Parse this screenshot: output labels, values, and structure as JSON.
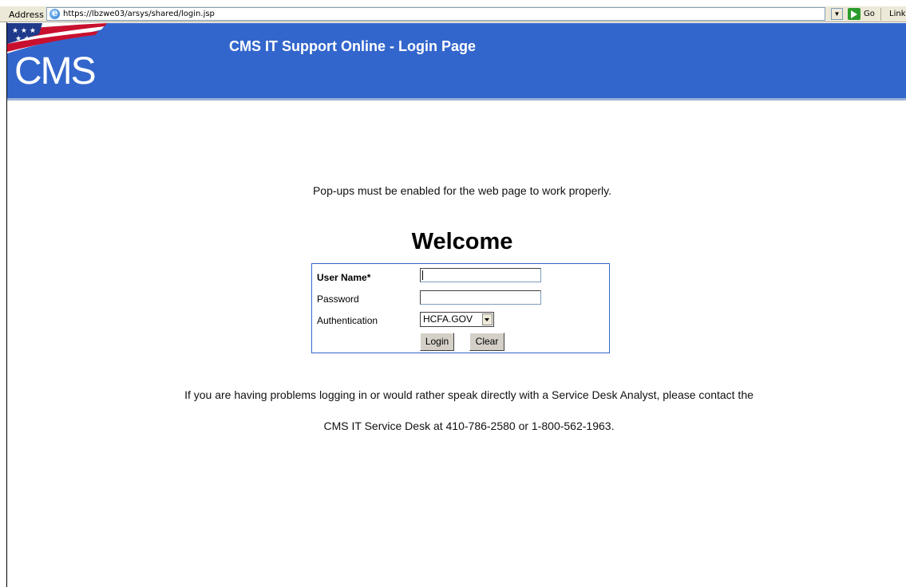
{
  "browser": {
    "address_label": "Address",
    "url": "https://lbzwe03/arsys/shared/login.jsp",
    "go_label": "Go",
    "links_label": "Link"
  },
  "banner": {
    "logo_text": "CMS",
    "title": "CMS IT Support Online - Login Page",
    "color": "#3366cc"
  },
  "notice": "Pop-ups must be enabled for the web page to work properly.",
  "welcome": "Welcome",
  "form": {
    "username_label": "User Name*",
    "username_value": "",
    "password_label": "Password",
    "password_value": "",
    "auth_label": "Authentication",
    "auth_selected": "HCFA.GOV",
    "login_button": "Login",
    "clear_button": "Clear"
  },
  "help": {
    "line1": "If you are having problems logging in or would rather speak directly with a Service Desk Analyst, please contact the",
    "line2": "CMS IT Service Desk at 410-786-2580 or 1-800-562-1963."
  }
}
